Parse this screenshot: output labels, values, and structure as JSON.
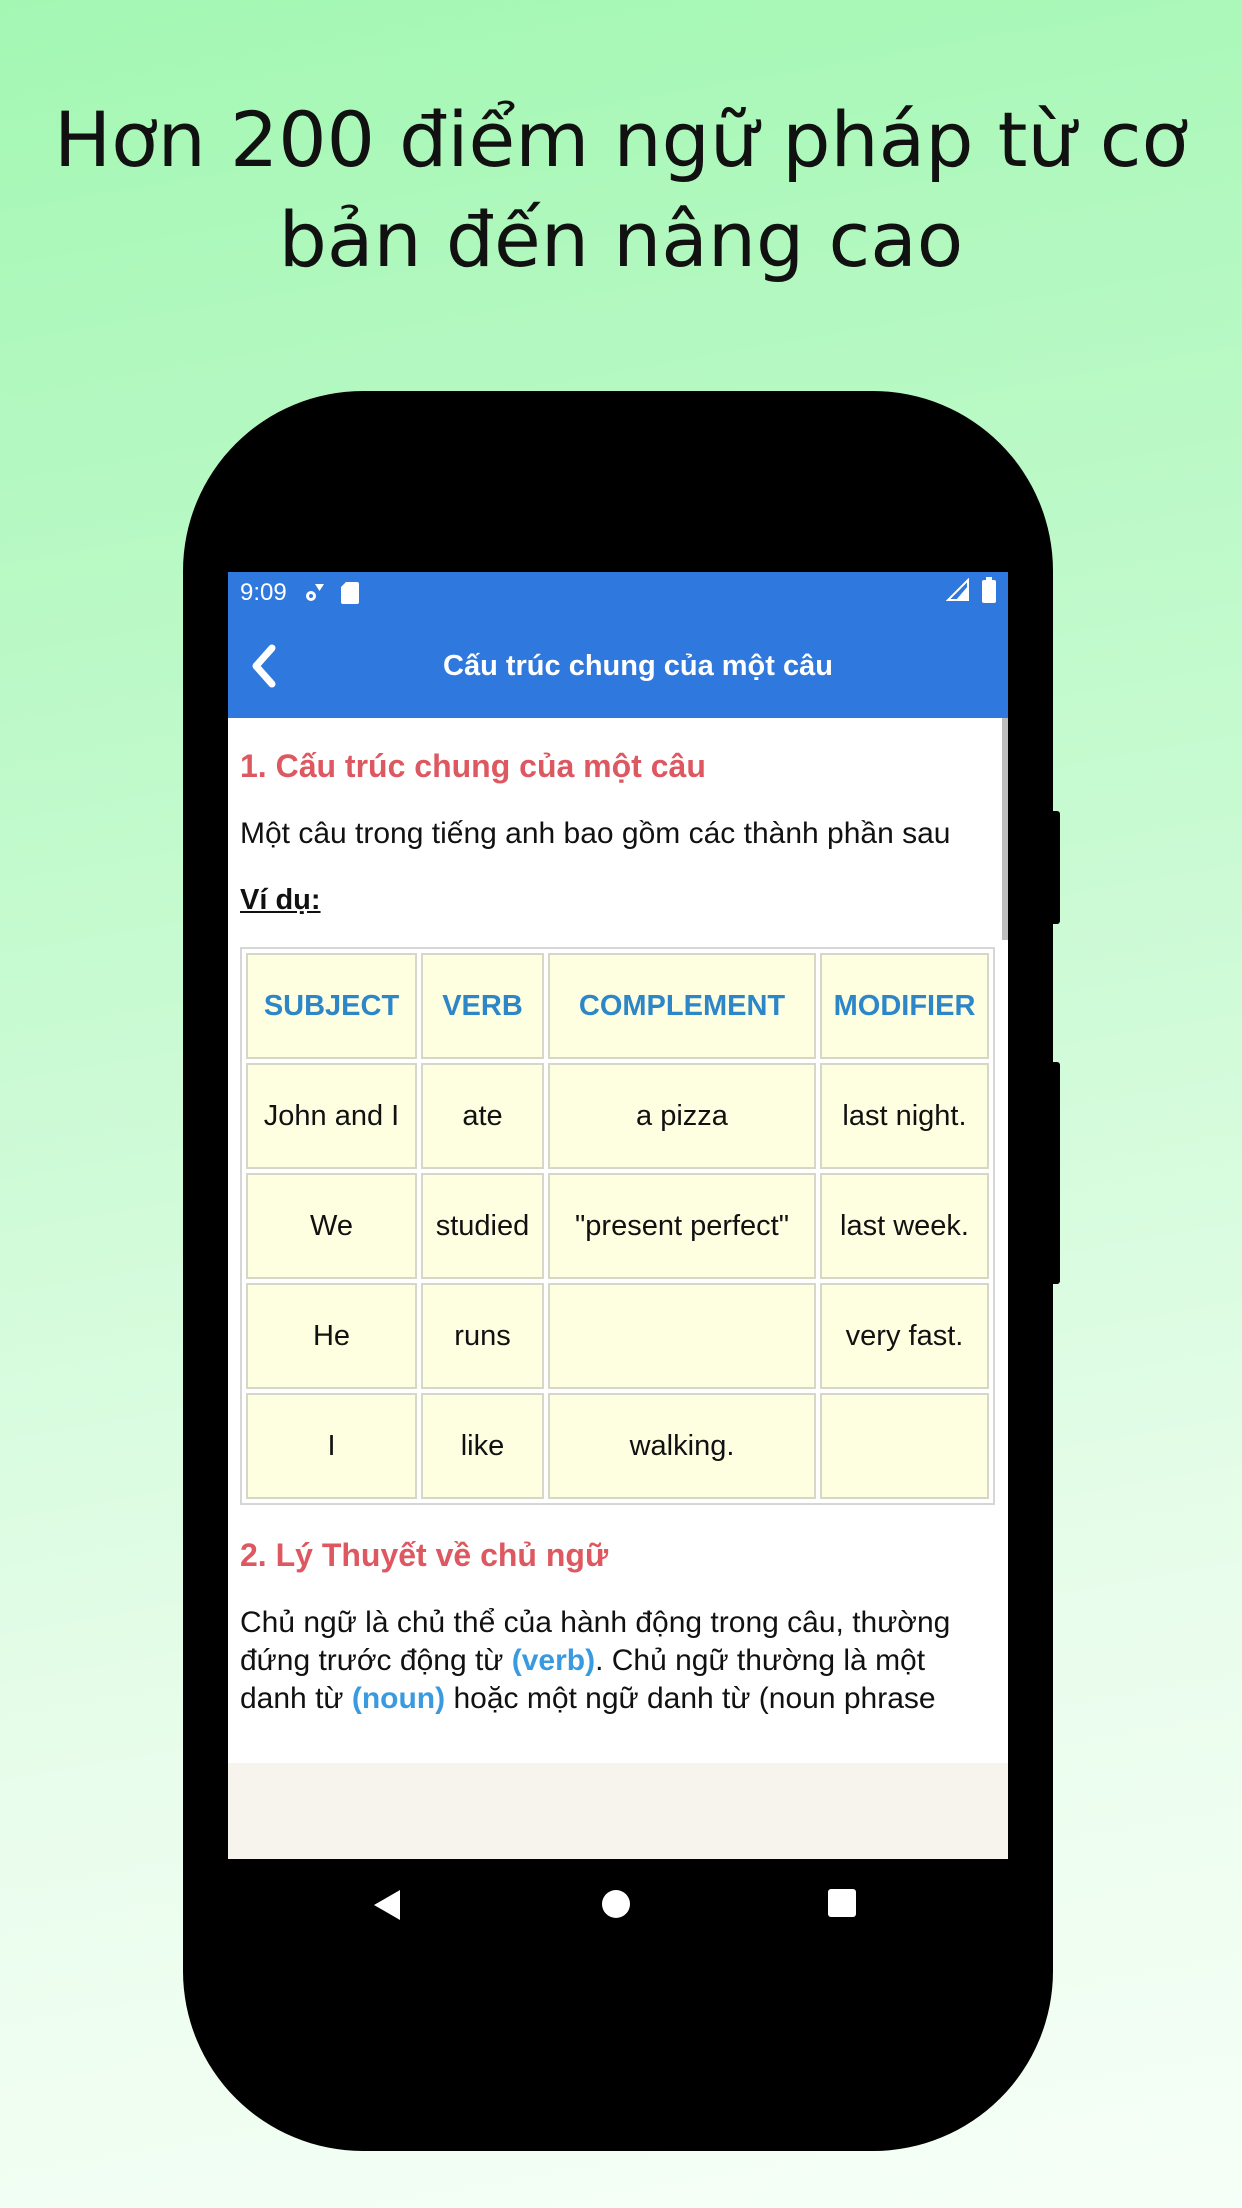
{
  "promo": {
    "line1": "Hơn 200 điểm ngữ pháp từ cơ",
    "line2": "bản đến nâng cao"
  },
  "status": {
    "time": "9:09",
    "icons": [
      "settings-icon",
      "sd-card-icon",
      "signal-icon",
      "battery-icon"
    ]
  },
  "appbar": {
    "title": "Cấu trúc chung của một câu",
    "back_icon": "chevron-left-icon"
  },
  "section1": {
    "heading": "1. Cấu trúc chung của một câu",
    "text": "Một câu trong tiếng anh bao gồm các thành phần sau",
    "example_label": "Ví dụ:"
  },
  "table": {
    "headers": [
      "SUBJECT",
      "VERB",
      "COMPLEMENT",
      "MODIFIER"
    ],
    "rows": [
      [
        "John and I",
        "ate",
        "a pizza",
        "last night."
      ],
      [
        "We",
        "studied",
        "\"present perfect\"",
        "last week."
      ],
      [
        "He",
        "runs",
        "",
        "very fast."
      ],
      [
        "I",
        "like",
        "walking.",
        ""
      ]
    ]
  },
  "section2": {
    "heading": "2. Lý Thuyết về chủ ngữ",
    "t1": "Chủ ngữ là chủ thể của hành động trong câu, thường đứng trước động từ ",
    "verb": "(verb)",
    "t2": ". Chủ ngữ thường là một danh từ ",
    "noun": "(noun)",
    "t3": " hoặc một ngữ danh từ (noun phrase"
  },
  "colors": {
    "appbar": "#2f78dd",
    "heading": "#dd5860",
    "table_header": "#2d86c8",
    "cell_bg": "#fdffe0",
    "highlight": "#3a9ae0"
  },
  "nav": {
    "icons": [
      "back-triangle-icon",
      "home-circle-icon",
      "recents-square-icon"
    ]
  }
}
